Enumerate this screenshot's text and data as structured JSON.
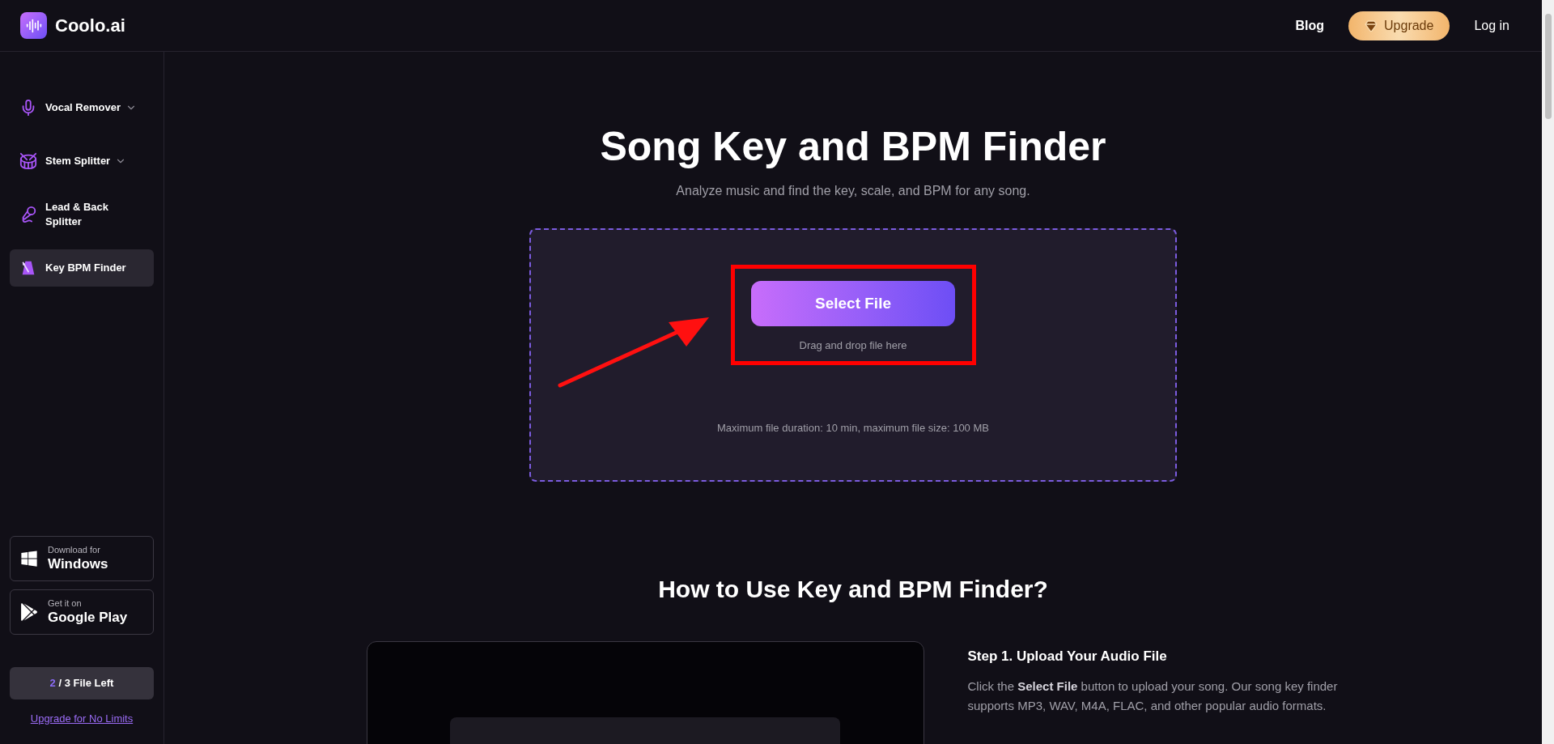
{
  "header": {
    "brand": "Coolo.ai",
    "nav": [
      {
        "label": "Blog",
        "kind": "link"
      },
      {
        "label": "Upgrade",
        "kind": "upgrade"
      },
      {
        "label": "Log in",
        "kind": "link"
      }
    ]
  },
  "sidebar": {
    "items": [
      {
        "label": "Vocal Remover",
        "expandable": true,
        "selected": false
      },
      {
        "label": "Stem Splitter",
        "expandable": true,
        "selected": false
      },
      {
        "label": "Lead & Back Splitter",
        "expandable": false,
        "selected": false
      },
      {
        "label": "Key BPM Finder",
        "expandable": false,
        "selected": true
      }
    ],
    "downloads": [
      {
        "kind": "windows",
        "small": "Download for",
        "big": "Windows"
      },
      {
        "kind": "play",
        "small": "Get it on",
        "big": "Google Play"
      }
    ],
    "quota": {
      "used": "2",
      "rest": "/ 3 File Left"
    },
    "upgrade_link": "Upgrade for No Limits"
  },
  "main": {
    "title": "Song Key and BPM Finder",
    "subtitle": "Analyze music and find the key, scale, and BPM for any song.",
    "upload": {
      "button": "Select File",
      "hint": "Drag and drop file here",
      "limits": "Maximum file duration: 10 min, maximum file size: 100 MB"
    },
    "how_to": {
      "heading": "How to Use Key and BPM Finder?",
      "steps": [
        {
          "title": "Step 1. Upload Your Audio File",
          "text": "Click the **Select File** button to upload your song. Our song key finder supports MP3, WAV, M4A, FLAC, and other popular audio formats."
        }
      ]
    }
  }
}
